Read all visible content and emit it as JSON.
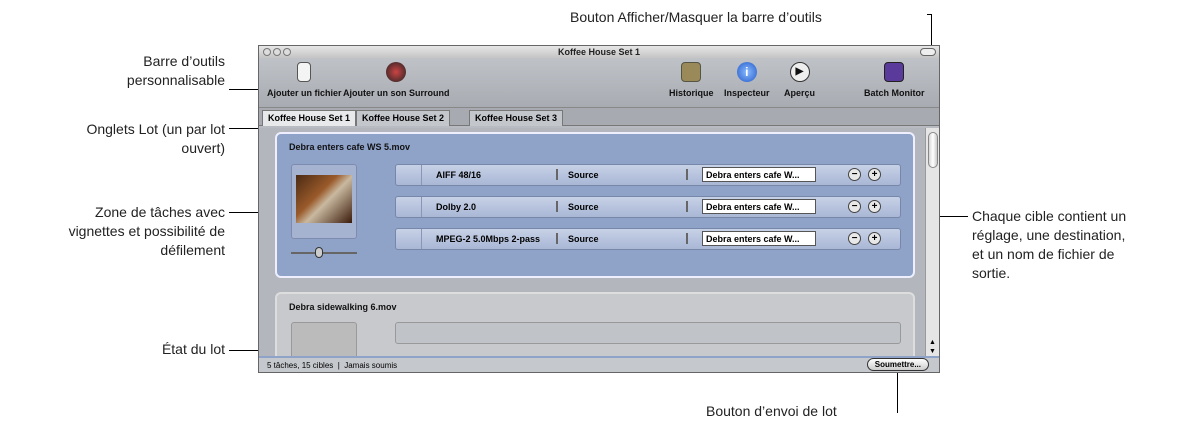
{
  "callouts": {
    "toolbar_toggle": "Bouton Afficher/Masquer la barre d’outils",
    "custom_toolbar": [
      "Barre d’outils",
      "personnalisable"
    ],
    "batch_tabs": [
      "Onglets Lot (un par lot",
      "ouvert)"
    ],
    "job_area": [
      "Zone de tâches avec",
      "vignettes et possibilité de",
      "défilement"
    ],
    "batch_status": "État du lot",
    "targets": [
      "Chaque cible contient un",
      "réglage, une destination,",
      "et un nom de fichier de",
      "sortie."
    ],
    "submit": "Bouton d’envoi de lot"
  },
  "window": {
    "title": "Koffee House Set 1"
  },
  "toolbar": {
    "add_file": "Ajouter un fichier",
    "add_surround": "Ajouter un son Surround",
    "history": "Historique",
    "inspector": "Inspecteur",
    "preview": "Aperçu",
    "batch_monitor": "Batch Monitor"
  },
  "tabs": [
    "Koffee House Set 1",
    "Koffee House Set 2",
    "Koffee House Set 3"
  ],
  "jobs": [
    {
      "title": "Debra enters cafe WS 5.mov",
      "targets": [
        {
          "setting": "AIFF 48/16",
          "destination": "Source",
          "filename": "Debra enters cafe W..."
        },
        {
          "setting": "Dolby 2.0",
          "destination": "Source",
          "filename": "Debra enters cafe W..."
        },
        {
          "setting": "MPEG-2 5.0Mbps 2-pass",
          "destination": "Source",
          "filename": "Debra enters cafe W..."
        }
      ]
    },
    {
      "title": "Debra sidewalking 6.mov"
    }
  ],
  "status": {
    "text": "5 tâches, 15 cibles  |  Jamais soumis",
    "submit": "Soumettre..."
  }
}
